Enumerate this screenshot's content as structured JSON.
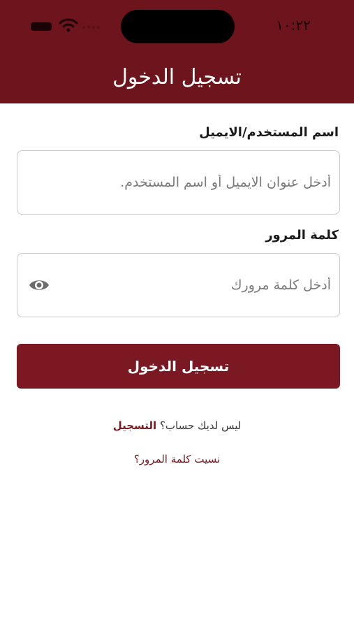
{
  "status_bar": {
    "time": "١٠:٢٢",
    "icons": [
      "battery-icon",
      "wifi-icon",
      "signal-icon"
    ]
  },
  "header": {
    "title": "تسجيل الدخول",
    "background_color": "#6e141c"
  },
  "form": {
    "username": {
      "label": "اسم المستخدم/الايميل",
      "placeholder": "أدخل عنوان الايميل أو اسم المستخدم.",
      "value": ""
    },
    "password": {
      "label": "كلمة المرور",
      "placeholder": "أدخل كلمة مرورك",
      "value": "",
      "toggle_icon": "eye-icon"
    },
    "login_button_label": "تسجيل الدخول"
  },
  "links": {
    "signup_prompt": "ليس لديك حساب؟",
    "signup_label": "التسجيل",
    "forgot_password": "نسيت كلمة المرور؟"
  },
  "colors": {
    "accent": "#7b1822",
    "header": "#6e141c"
  }
}
